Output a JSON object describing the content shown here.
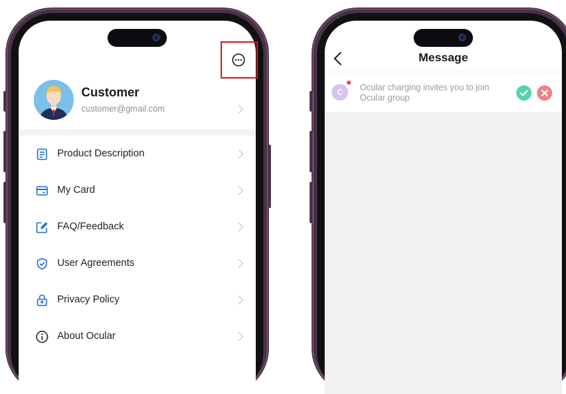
{
  "left_screen": {
    "profile": {
      "name": "Customer",
      "email": "customer@gmail.com"
    },
    "menu": [
      {
        "label": "Product Description",
        "icon": "document-icon"
      },
      {
        "label": "My Card",
        "icon": "card-icon"
      },
      {
        "label": "FAQ/Feedback",
        "icon": "edit-icon"
      },
      {
        "label": "User Agreements",
        "icon": "shield-check-icon"
      },
      {
        "label": "Privacy Policy",
        "icon": "lock-icon"
      },
      {
        "label": "About Ocular",
        "icon": "info-icon"
      }
    ],
    "highlight_color": "#e0141e"
  },
  "right_screen": {
    "title": "Message",
    "message": {
      "avatar_letter": "C",
      "text": "Ocular charging invites you to join Ocular group"
    },
    "colors": {
      "accept": "#56d3ae",
      "reject": "#f17f84"
    }
  }
}
